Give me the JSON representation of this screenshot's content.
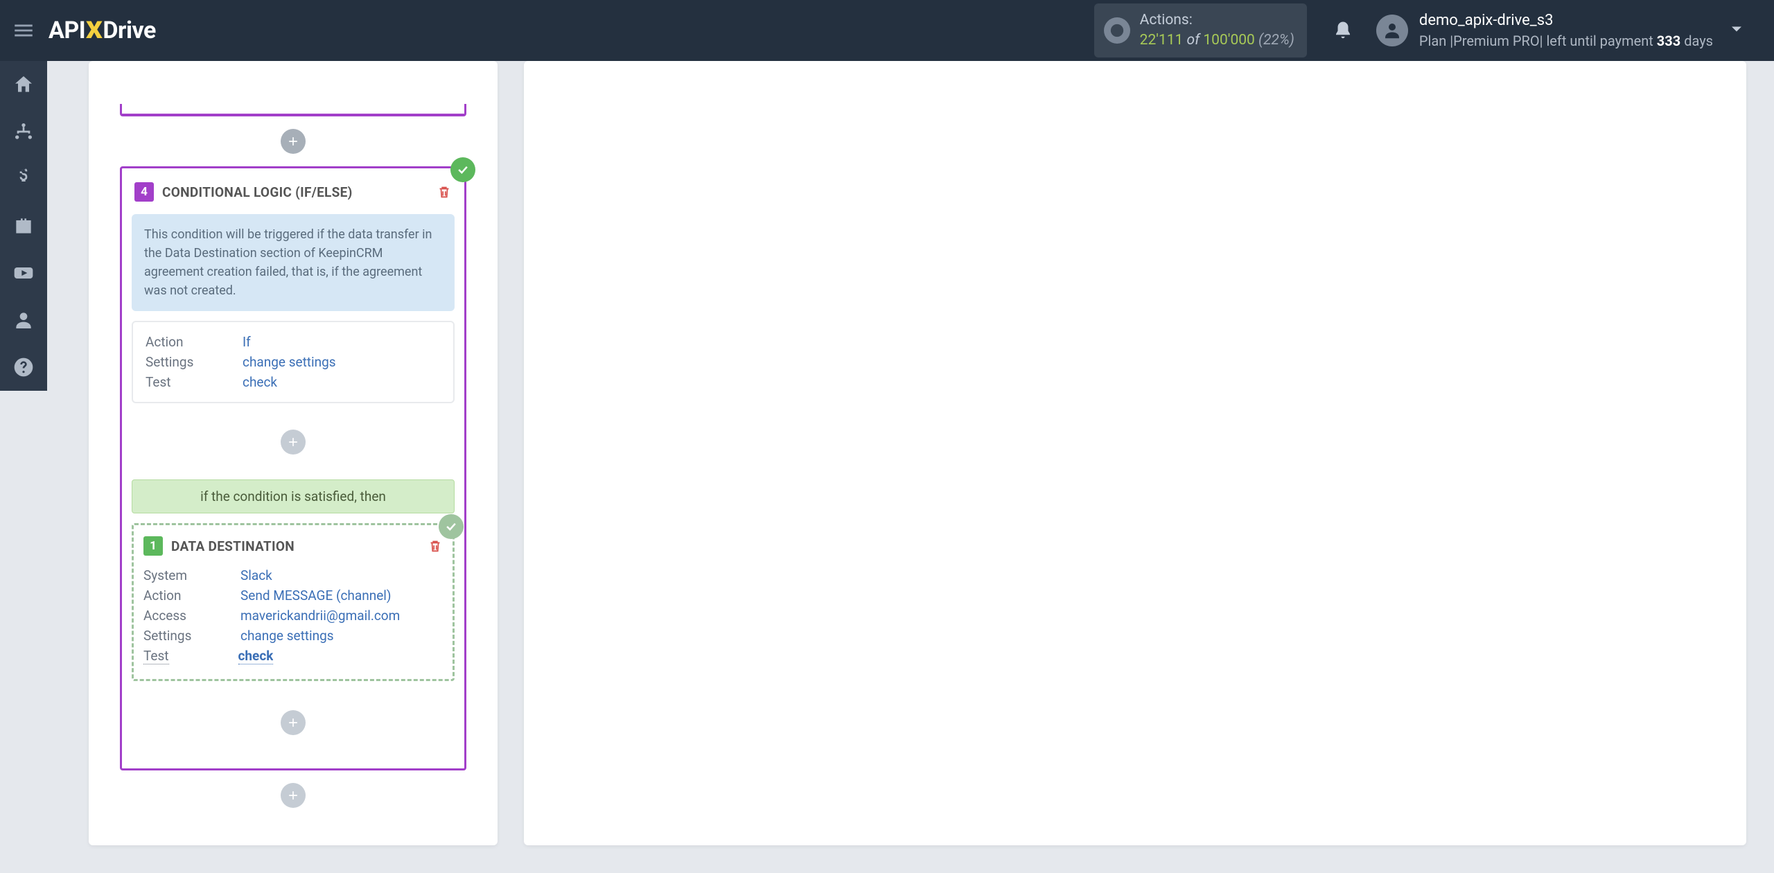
{
  "header": {
    "logo_left": "API",
    "logo_x": "X",
    "logo_right": "Drive",
    "actions_label": "Actions:",
    "actions_used": "22'111",
    "actions_of": " of ",
    "actions_total": "100'000",
    "actions_pct": " (22%)",
    "user_name": "demo_apix-drive_s3",
    "plan_prefix": "Plan |Premium PRO| left until payment ",
    "plan_days": "333",
    "plan_suffix": " days"
  },
  "step4": {
    "num": "4",
    "title": "CONDITIONAL LOGIC (IF/ELSE)",
    "info": "This condition will be triggered if the data transfer in the Data Destination section of KeepinCRM agreement creation failed, that is, if the agreement was not created.",
    "rows": {
      "action_label": "Action",
      "action_value": "If",
      "settings_label": "Settings",
      "settings_value": "change settings",
      "test_label": "Test",
      "test_value": "check"
    }
  },
  "branch_label": "if the condition is satisfied, then",
  "nested": {
    "num": "1",
    "title": "DATA DESTINATION",
    "rows": {
      "system_label": "System",
      "system_value": "Slack",
      "action_label": "Action",
      "action_value": "Send MESSAGE (channel)",
      "access_label": "Access",
      "access_value": "maverickandrii@gmail.com",
      "settings_label": "Settings",
      "settings_value": "change settings",
      "test_label": "Test",
      "test_value": "check"
    }
  }
}
